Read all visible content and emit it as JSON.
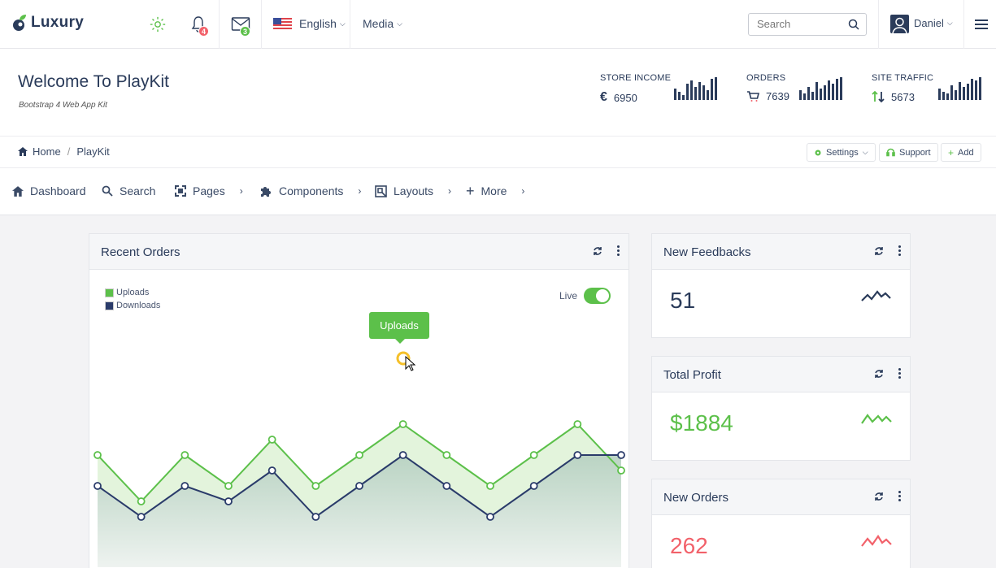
{
  "brand": {
    "name": "Luxury"
  },
  "topbar": {
    "notifications_count": "4",
    "messages_count": "3",
    "language": "English",
    "media": "Media",
    "search_placeholder": "Search",
    "user": "Daniel"
  },
  "header": {
    "title": "Welcome To PlayKit",
    "subtitle": "Bootstrap 4 Web App Kit",
    "stats": [
      {
        "label": "STORE INCOME",
        "value": "6950",
        "icon": "euro-icon"
      },
      {
        "label": "ORDERS",
        "value": "7639",
        "icon": "cart-icon"
      },
      {
        "label": "SITE TRAFFIC",
        "value": "5673",
        "icon": "traffic-arrows-icon"
      }
    ]
  },
  "breadcrumb": {
    "home": "Home",
    "current": "PlayKit"
  },
  "toolbar": {
    "settings": "Settings",
    "support": "Support",
    "add": "Add"
  },
  "menu": [
    {
      "label": "Dashboard",
      "icon": "home-icon"
    },
    {
      "label": "Search",
      "icon": "search-icon"
    },
    {
      "label": "Pages",
      "icon": "pages-icon"
    },
    {
      "label": "Components",
      "icon": "puzzle-icon"
    },
    {
      "label": "Layouts",
      "icon": "layouts-icon"
    },
    {
      "label": "More",
      "icon": "plus-icon"
    }
  ],
  "recent_orders": {
    "title": "Recent Orders",
    "live_label": "Live",
    "tooltip": "Uploads",
    "legend": [
      {
        "name": "Uploads",
        "color": "#5cc04a"
      },
      {
        "name": "Downloads",
        "color": "#2a3b6a"
      }
    ]
  },
  "chart_data": {
    "type": "area",
    "series": [
      {
        "name": "Uploads",
        "values": [
          10,
          7,
          10,
          8,
          11,
          8,
          10,
          12,
          10,
          8,
          10,
          12,
          9
        ]
      },
      {
        "name": "Downloads",
        "values": [
          8,
          6,
          8,
          7,
          9,
          6,
          8,
          10,
          8,
          6,
          8,
          10,
          10
        ]
      }
    ],
    "ylim": [
      0,
      20
    ],
    "grid": false,
    "legend_position": "top-left"
  },
  "feedbacks": {
    "title": "New Feedbacks",
    "value": "51",
    "color": "#2a3b5a"
  },
  "profit": {
    "title": "Total Profit",
    "value": "$1884",
    "color": "#5cc04a"
  },
  "orders": {
    "title": "New Orders",
    "value": "262",
    "color": "#f2616a"
  },
  "colors": {
    "accent_green": "#5cc04a",
    "navy": "#2a3b5a",
    "red": "#f2616a",
    "badge_red": "#f2616a",
    "badge_green": "#5cc04a"
  }
}
